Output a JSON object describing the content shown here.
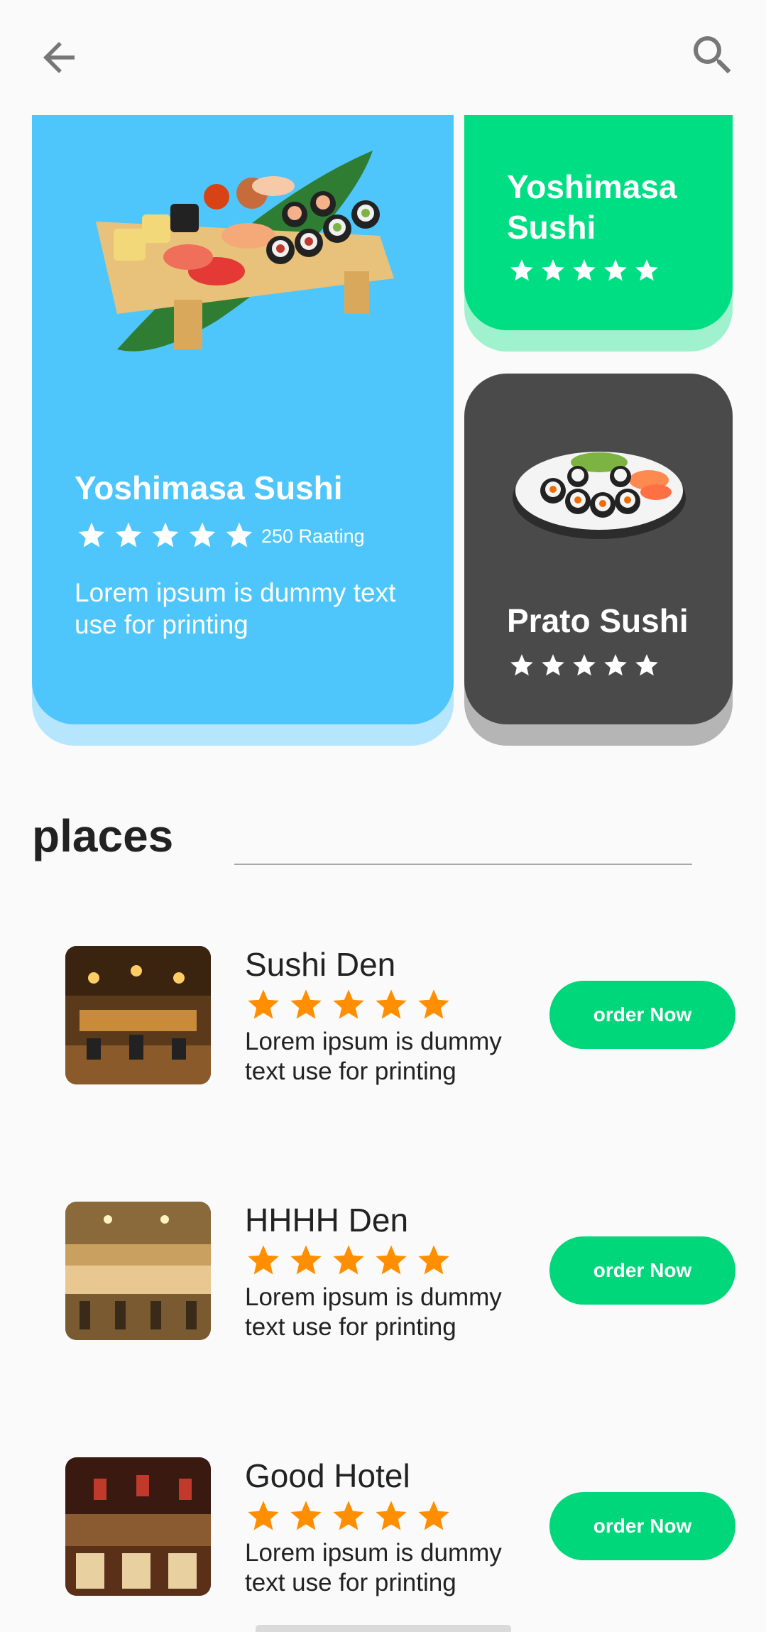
{
  "topbar": {
    "back_icon": "arrow-left-icon",
    "search_icon": "search-icon",
    "icon_color": "#777777"
  },
  "featured": {
    "main": {
      "title": "Yoshimasa Sushi",
      "stars": 5,
      "rating_text": "250 Raating",
      "description": "Lorem ipsum is dummy text use for printing",
      "bg_color": "#4fc6fb"
    },
    "top_right": {
      "title_line1": "Yoshimasa",
      "title_line2": "Sushi",
      "stars": 5,
      "bg_color": "#00de84"
    },
    "bottom_right": {
      "title": "Prato Sushi",
      "stars": 5,
      "bg_color": "#4a4a4a"
    }
  },
  "places": {
    "title": "places",
    "items": [
      {
        "name": "Sushi Den",
        "stars": 5,
        "description": "Lorem ipsum is dummy text use for printing",
        "button": "order Now"
      },
      {
        "name": "HHHH Den",
        "stars": 5,
        "description": "Lorem ipsum is dummy text use for printing",
        "button": "order Now"
      },
      {
        "name": "Good Hotel",
        "stars": 5,
        "description": "Lorem ipsum is dummy text use for printing",
        "button": "order Now"
      }
    ]
  },
  "colors": {
    "accent_green": "#00d67a",
    "star_orange": "#ff8f00"
  }
}
